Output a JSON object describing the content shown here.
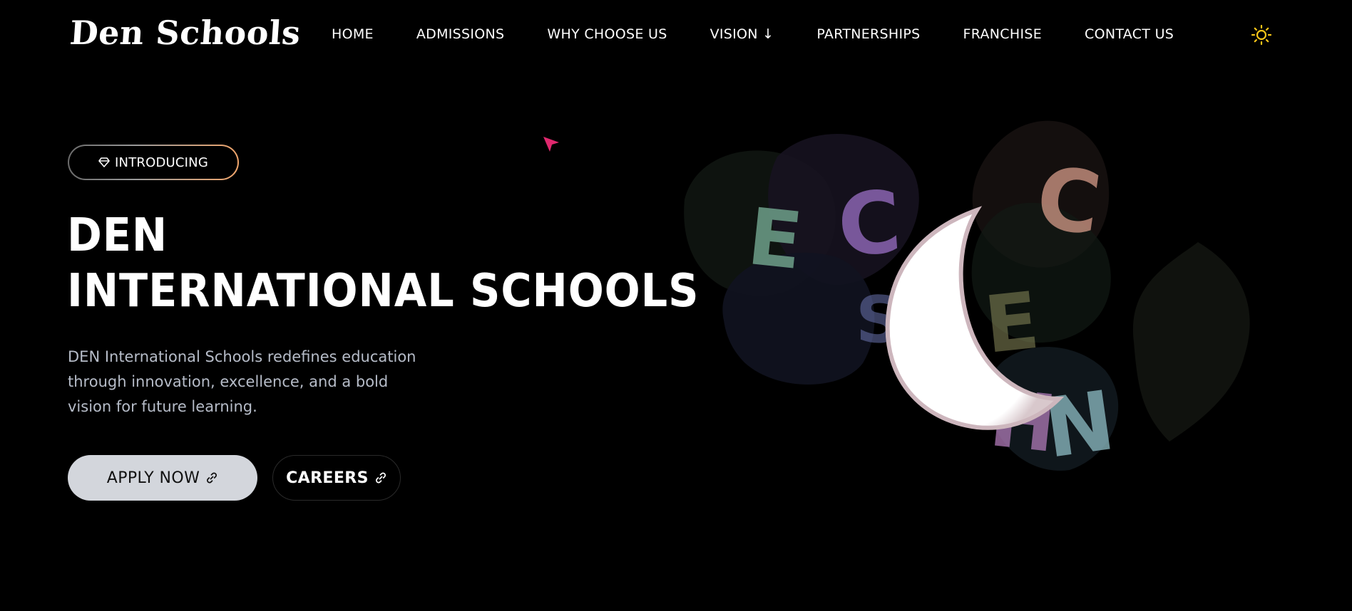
{
  "brand": {
    "logo_text": "Den Schools"
  },
  "nav": {
    "items": [
      {
        "label": "HOME"
      },
      {
        "label": "ADMISSIONS"
      },
      {
        "label": "WHY CHOOSE US"
      },
      {
        "label": "VISION ↓"
      },
      {
        "label": "PARTNERSHIPS"
      },
      {
        "label": "FRANCHISE"
      },
      {
        "label": "CONTACT US"
      }
    ],
    "theme_toggle_icon": "sun-icon",
    "theme_toggle_color": "#f5c518"
  },
  "hero": {
    "badge": {
      "label": "INTRODUCING",
      "icon": "diamond-icon"
    },
    "title_line1": "DEN",
    "title_line2": "INTERNATIONAL SCHOOLS",
    "description": "DEN International Schools redefines education through innovation, excellence, and a bold vision for future learning.",
    "buttons": {
      "apply_label": "APPLY NOW",
      "careers_label": "CAREERS",
      "link_icon": "link-icon"
    }
  },
  "art": {
    "letters": [
      "E",
      "C",
      "C",
      "E",
      "H",
      "N",
      "S"
    ]
  },
  "colors": {
    "background": "#000000",
    "badge_gradient_end": "#f0a56b",
    "apply_button_bg": "#d3d6dc",
    "cursor_accent": "#e0286e",
    "description_text": "#b6bcc8"
  }
}
